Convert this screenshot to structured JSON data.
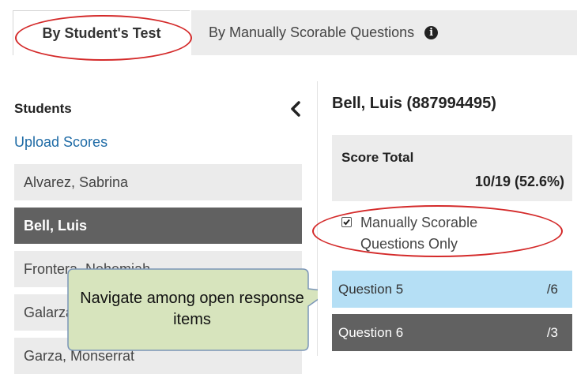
{
  "tabs": [
    {
      "label": "By Student's Test",
      "active": true
    },
    {
      "label": "By Manually Scorable Questions",
      "active": false
    }
  ],
  "students_panel": {
    "title": "Students",
    "upload_link": "Upload Scores",
    "items": [
      {
        "name": "Alvarez, Sabrina",
        "selected": false
      },
      {
        "name": "Bell, Luis",
        "selected": true
      },
      {
        "name": "Frontera, Nehemiah",
        "selected": false
      },
      {
        "name": "Galarza, Valeria",
        "selected": false
      },
      {
        "name": "Garza, Monserrat",
        "selected": false
      }
    ]
  },
  "detail": {
    "student_header": "Bell, Luis (887994495)",
    "score_label": "Score Total",
    "score_value": "10/19 (52.6%)",
    "checkbox_label": "Manually Scorable Questions Only",
    "checkbox_checked": true,
    "questions": [
      {
        "label": "Question 5",
        "points": "/6",
        "state": "active"
      },
      {
        "label": "Question 6",
        "points": "/3",
        "state": "dark"
      }
    ]
  },
  "callout": {
    "text": "Navigate among open response items"
  },
  "colors": {
    "annotation_red": "#d42a2a",
    "callout_fill": "#d7e4bd",
    "callout_border": "#7a95b8",
    "link_blue": "#1d6aa5",
    "selected_row": "#616161",
    "active_question": "#b5dff5"
  }
}
